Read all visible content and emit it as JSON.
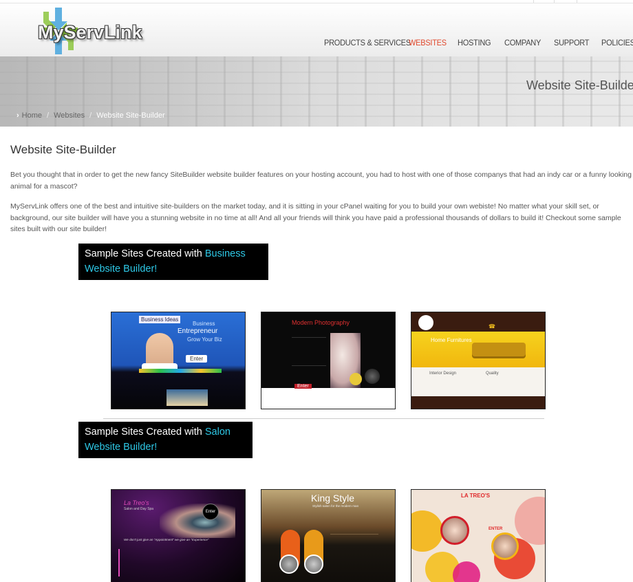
{
  "brand": {
    "logo_text": "MyServLink"
  },
  "nav": {
    "items": [
      {
        "label": "PRODUCTS & SERVICES",
        "active": false
      },
      {
        "label": "WEBSITES",
        "active": true
      },
      {
        "label": "HOSTING",
        "active": false
      },
      {
        "label": "COMPANY",
        "active": false
      },
      {
        "label": "SUPPORT",
        "active": false
      },
      {
        "label": "POLICIES",
        "active": false
      }
    ]
  },
  "banner": {
    "title": "Website Site-Builder",
    "breadcrumb": [
      "Home",
      "Websites",
      "Website Site-Builder"
    ]
  },
  "content": {
    "title": "Website Site-Builder",
    "paragraph1": "Bet you thought that in order to get the new fancy SiteBuilder website builder features on your hosting account, you had to host with one of those companys that had an indy car or a funny looking animal for a mascot?",
    "paragraph2": "MyServLink offers one of the best and intuitive site-builders on the market today, and it is sitting in your cPanel waiting for you to build your own webiste!  No matter what your skill set, or background, our site builder will have you a stunning website in no time at all!  And all your friends will think you have paid a professional thousands of dollars to build it!  Checkout some sample sites built with our site builder!"
  },
  "sections": [
    {
      "heading_prefix": "Sample Sites Created with ",
      "heading_highlight": "Business Website Builder!",
      "thumbnails": [
        {
          "caption_1": "Business Ideas",
          "caption_2": "Business",
          "caption_3": "Entrepreneur",
          "caption_4": "Grow Your Biz",
          "button": "Enter"
        },
        {
          "caption_1": "Modern Photography",
          "button": "Enter"
        },
        {
          "caption_1": "Home Furnitures",
          "caption_2": "Interior Design",
          "caption_3": "Quality"
        }
      ]
    },
    {
      "heading_prefix": "Sample Sites Created with ",
      "heading_highlight": "Salon Website Builder!",
      "thumbnails": [
        {
          "caption_1": "La Treo's",
          "caption_2": "Salon and Day Spa",
          "button": "Enter",
          "tagline": "We don't just give an \"Appointment\" we give an \"Experience\""
        },
        {
          "caption_1": "King Style",
          "caption_2": "Stylish salon for the modern man"
        },
        {
          "caption_1": "LA TREO'S",
          "button": "ENTER"
        }
      ]
    }
  ],
  "colors": {
    "accent": "#e0482c",
    "highlight": "#2ec8e6"
  }
}
